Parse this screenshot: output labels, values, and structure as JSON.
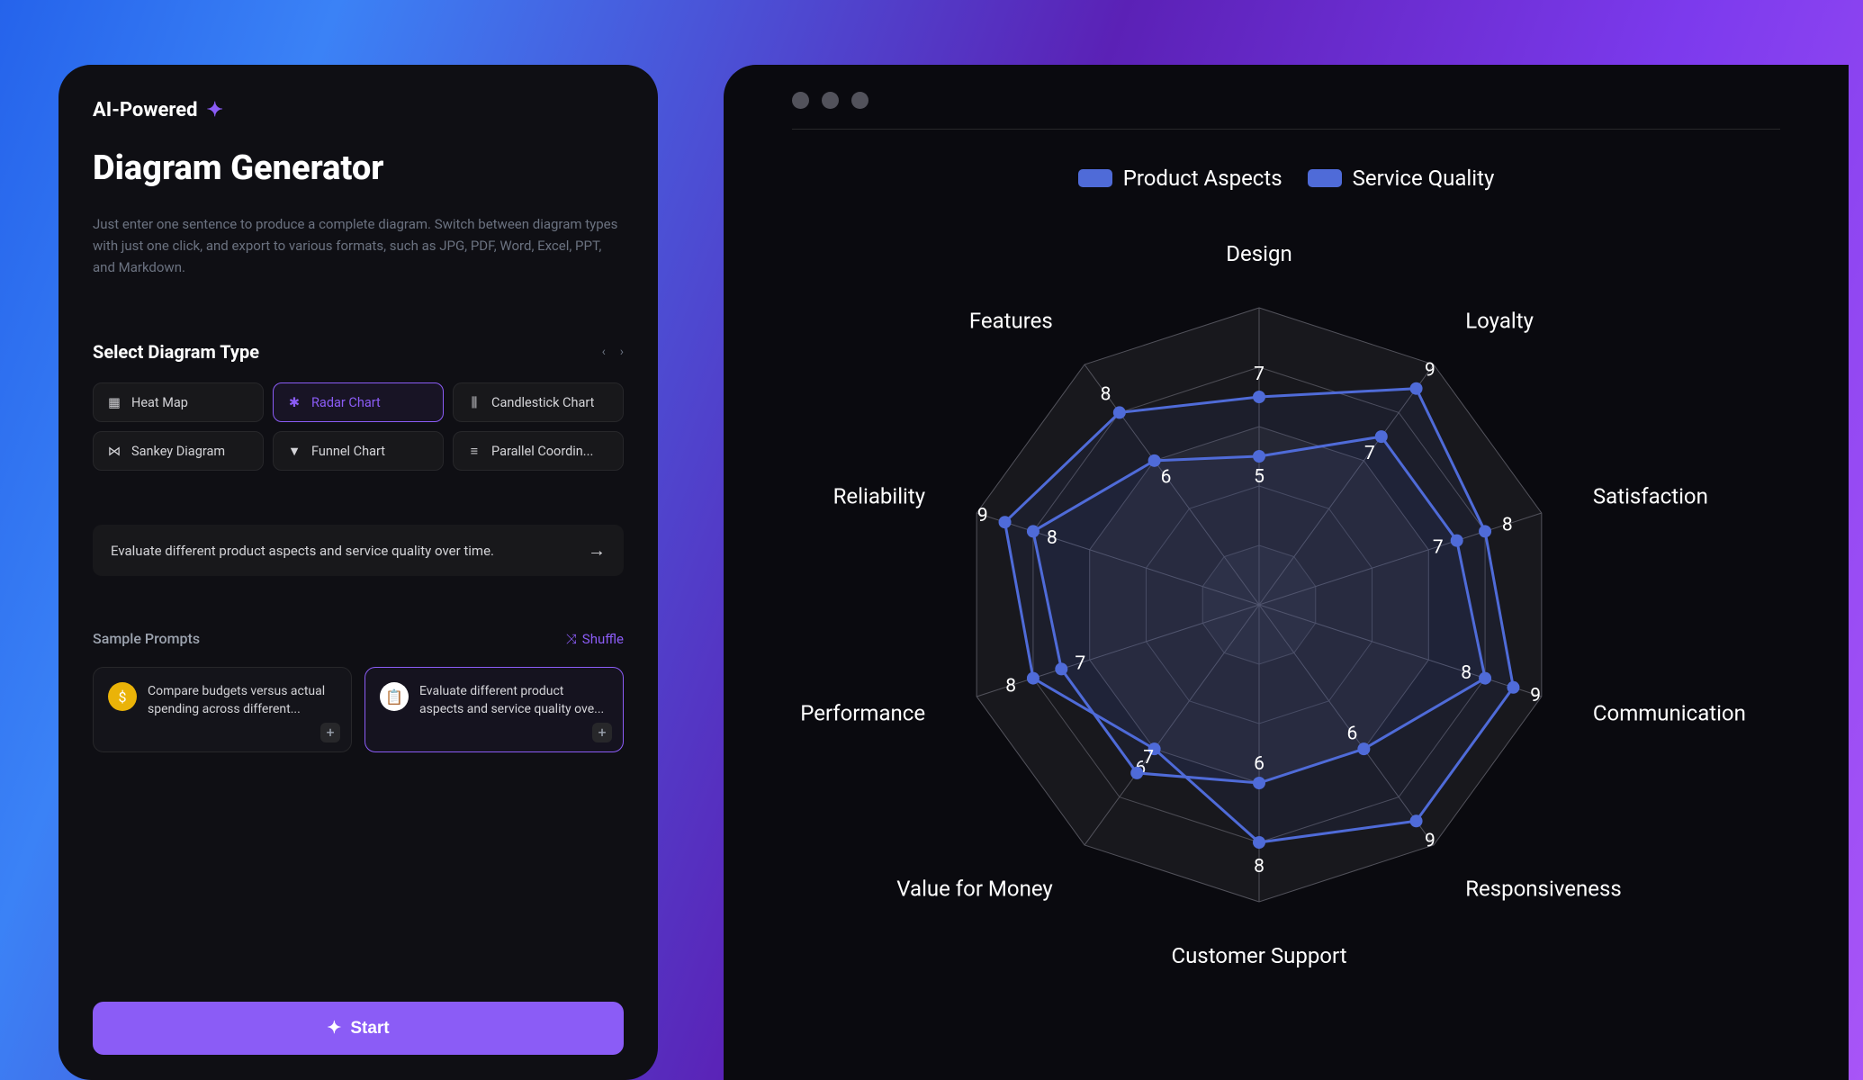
{
  "leftPanel": {
    "badge": "AI-Powered",
    "title": "Diagram Generator",
    "description": "Just enter one sentence to produce a complete diagram. Switch between diagram types with just one click, and export to various formats, such as JPG, PDF, Word, Excel, PPT, and Markdown.",
    "selectLabel": "Select Diagram Type",
    "pagerActive": 2,
    "pagerCount": 5,
    "diagramTypes": [
      {
        "label": "Heat Map",
        "selected": false
      },
      {
        "label": "Radar Chart",
        "selected": true
      },
      {
        "label": "Candlestick Chart",
        "selected": false
      },
      {
        "label": "Sankey Diagram",
        "selected": false
      },
      {
        "label": "Funnel Chart",
        "selected": false
      },
      {
        "label": "Parallel Coordin...",
        "selected": false
      }
    ],
    "promptValue": "Evaluate different product aspects and service quality over time.",
    "samplesLabel": "Sample Prompts",
    "shuffleLabel": "Shuffle",
    "samples": [
      {
        "text": "Compare budgets versus actual spending across different...",
        "selected": false,
        "iconColor": "yellow",
        "iconGlyph": "$"
      },
      {
        "text": "Evaluate different product aspects and service quality ove...",
        "selected": true,
        "iconColor": "orange",
        "iconGlyph": "📋"
      }
    ],
    "startLabel": "Start"
  },
  "chart_data": {
    "type": "radar",
    "categories": [
      "Design",
      "Loyalty",
      "Satisfaction",
      "Communication",
      "Responsiveness",
      "Customer Support",
      "Value for Money",
      "Performance",
      "Reliability",
      "Features"
    ],
    "rmax": 10,
    "rings": 5,
    "series": [
      {
        "name": "Product Aspects",
        "values": [
          7,
          9,
          8,
          9,
          9,
          8,
          6,
          8,
          9,
          8
        ],
        "color": "#4f6bd8"
      },
      {
        "name": "Service Quality",
        "values": [
          5,
          7,
          7,
          8,
          6,
          6,
          7,
          7,
          8,
          6
        ],
        "color": "#4f6bd8"
      }
    ]
  }
}
